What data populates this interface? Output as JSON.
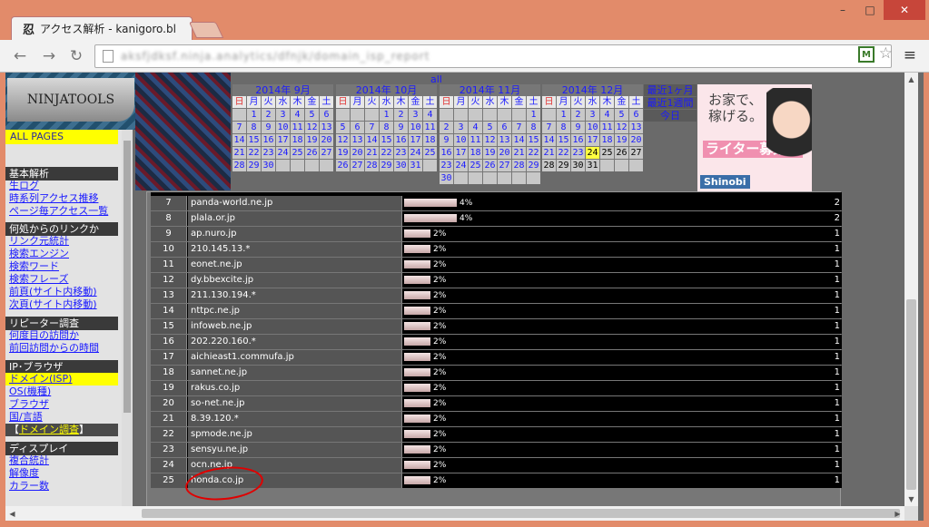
{
  "window": {
    "tab_title": "アクセス解析 - kanigoro.bl",
    "tab_favicon": "忍",
    "minimize": "–",
    "maximize": "□",
    "close": "✕"
  },
  "toolbar": {
    "url": "aksfjdksf.ninja.analytics/dfnjk/domain_isp_report",
    "back_icon": "←",
    "forward_icon": "→",
    "reload_icon": "↻",
    "extension_label": "M",
    "star_icon": "☆",
    "menu_icon": "≡"
  },
  "site": {
    "logo": "NINJATOOLS",
    "all_link": "all"
  },
  "sidebar": {
    "all_pages": "ALL PAGES",
    "sections": [
      {
        "title": "基本解析",
        "items": [
          "生ログ",
          "時系列アクセス推移",
          "ページ毎アクセス一覧"
        ]
      },
      {
        "title": "何処からのリンクか",
        "items": [
          "リンク元統計",
          "検索エンジン",
          "検索ワード",
          "検索フレーズ",
          "前頁(サイト内移動)",
          "次頁(サイト内移動)"
        ]
      },
      {
        "title": "リピーター調査",
        "items": [
          "何度目の訪問か",
          "前回訪問からの時間"
        ]
      },
      {
        "title": "IP･ブラウザ",
        "items": [
          "ドメイン(ISP)",
          "OS(機種)",
          "ブラウザ",
          "国/言語"
        ]
      },
      {
        "title": "ディスプレイ",
        "items": [
          "複合統計",
          "解像度",
          "カラー数"
        ]
      }
    ],
    "domain_survey": "ドメイン調査",
    "bracket_open": "【",
    "bracket_close": "】"
  },
  "calendar": {
    "weekdays": [
      "日",
      "月",
      "火",
      "水",
      "木",
      "金",
      "土"
    ],
    "months": [
      {
        "title": "2014年 9月",
        "offset": 1,
        "days": 30,
        "past_from": 99,
        "today": 0
      },
      {
        "title": "2014年 10月",
        "offset": 3,
        "days": 31,
        "past_from": 99,
        "today": 0
      },
      {
        "title": "2014年 11月",
        "offset": 6,
        "days": 30,
        "past_from": 99,
        "today": 0
      },
      {
        "title": "2014年 12月",
        "offset": 1,
        "days": 31,
        "past_from": 24,
        "today": 24
      }
    ],
    "quick_links": [
      "最近1ヶ月",
      "最近1週間",
      "今日"
    ]
  },
  "ad": {
    "line1": "お家で、",
    "line2": "稼げる。",
    "badge": "ライター募集！",
    "brand": "Shinobi"
  },
  "table": {
    "rows": [
      {
        "num": "7",
        "domain": "panda-world.ne.jp",
        "pct": "4%",
        "pct_value": 4,
        "count": "2"
      },
      {
        "num": "8",
        "domain": "plala.or.jp",
        "pct": "4%",
        "pct_value": 4,
        "count": "2"
      },
      {
        "num": "9",
        "domain": "ap.nuro.jp",
        "pct": "2%",
        "pct_value": 2,
        "count": "1"
      },
      {
        "num": "10",
        "domain": "210.145.13.*",
        "pct": "2%",
        "pct_value": 2,
        "count": "1"
      },
      {
        "num": "11",
        "domain": "eonet.ne.jp",
        "pct": "2%",
        "pct_value": 2,
        "count": "1"
      },
      {
        "num": "12",
        "domain": "dy.bbexcite.jp",
        "pct": "2%",
        "pct_value": 2,
        "count": "1"
      },
      {
        "num": "13",
        "domain": "211.130.194.*",
        "pct": "2%",
        "pct_value": 2,
        "count": "1"
      },
      {
        "num": "14",
        "domain": "nttpc.ne.jp",
        "pct": "2%",
        "pct_value": 2,
        "count": "1"
      },
      {
        "num": "15",
        "domain": "infoweb.ne.jp",
        "pct": "2%",
        "pct_value": 2,
        "count": "1"
      },
      {
        "num": "16",
        "domain": "202.220.160.*",
        "pct": "2%",
        "pct_value": 2,
        "count": "1"
      },
      {
        "num": "17",
        "domain": "aichieast1.commufa.jp",
        "pct": "2%",
        "pct_value": 2,
        "count": "1"
      },
      {
        "num": "18",
        "domain": "sannet.ne.jp",
        "pct": "2%",
        "pct_value": 2,
        "count": "1"
      },
      {
        "num": "19",
        "domain": "rakus.co.jp",
        "pct": "2%",
        "pct_value": 2,
        "count": "1"
      },
      {
        "num": "20",
        "domain": "so-net.ne.jp",
        "pct": "2%",
        "pct_value": 2,
        "count": "1"
      },
      {
        "num": "21",
        "domain": "8.39.120.*",
        "pct": "2%",
        "pct_value": 2,
        "count": "1"
      },
      {
        "num": "22",
        "domain": "spmode.ne.jp",
        "pct": "2%",
        "pct_value": 2,
        "count": "1"
      },
      {
        "num": "23",
        "domain": "sensyu.ne.jp",
        "pct": "2%",
        "pct_value": 2,
        "count": "1"
      },
      {
        "num": "24",
        "domain": "ocn.ne.jp",
        "pct": "2%",
        "pct_value": 2,
        "count": "1"
      },
      {
        "num": "25",
        "domain": "honda.co.jp",
        "pct": "2%",
        "pct_value": 2,
        "count": "1"
      }
    ]
  },
  "colors": {
    "titlebar": "#e28b6a",
    "highlight": "#ffff00",
    "link": "#1a1aff",
    "annotation": "#e00000"
  }
}
